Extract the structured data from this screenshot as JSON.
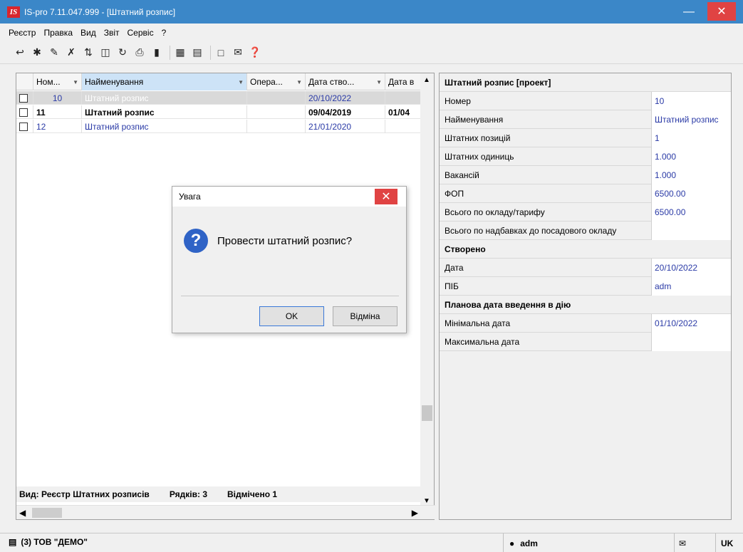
{
  "window": {
    "title": "IS-pro 7.11.047.999 - [Штатний розпис]",
    "logo": "IS"
  },
  "menu": [
    "Реєстр",
    "Правка",
    "Вид",
    "Звіт",
    "Сервіс",
    "?"
  ],
  "grid": {
    "columns": [
      "Ном...",
      "Найменування",
      "Опера...",
      "Дата ство...",
      "Дата в"
    ],
    "rows": [
      {
        "checked": true,
        "num": "10",
        "name": "Штатний розпис",
        "op": "",
        "created": "20/10/2022",
        "date_in": ""
      },
      {
        "checked": false,
        "num": "11",
        "name": "Штатний розпис",
        "op": "",
        "created": "09/04/2019",
        "date_in": "01/04"
      },
      {
        "checked": false,
        "num": "12",
        "name": "Штатний розпис",
        "op": "",
        "created": "21/01/2020",
        "date_in": ""
      }
    ],
    "status": {
      "view": "Вид: Реєстр Штатних розписів",
      "rows": "Рядків: 3",
      "marked": "Відмічено 1"
    }
  },
  "props": {
    "header": "Штатний розпис [проект]",
    "rows": [
      {
        "label": "Номер",
        "value": "10"
      },
      {
        "label": "Найменування",
        "value": "Штатний розпис"
      },
      {
        "label": "Штатних позицій",
        "value": "1"
      },
      {
        "label": "Штатних одиниць",
        "value": "1.000"
      },
      {
        "label": "Вакансій",
        "value": "1.000"
      },
      {
        "label": "ФОП",
        "value": "6500.00"
      },
      {
        "label": "Всього по окладу/тарифу",
        "value": "6500.00"
      },
      {
        "label": "Всього по надбавках до посадового окладу",
        "value": ""
      }
    ],
    "created_header": "Створено",
    "created_rows": [
      {
        "label": "Дата",
        "value": "20/10/2022"
      },
      {
        "label": "ПІБ",
        "value": "adm"
      }
    ],
    "plan_header": "Планова дата введення в дію",
    "plan_rows": [
      {
        "label": "Мінімальна дата",
        "value": "01/10/2022"
      },
      {
        "label": "Максимальна дата",
        "value": ""
      }
    ]
  },
  "dialog": {
    "title": "Увага",
    "message": "Провести штатний розпис?",
    "ok": "OK",
    "cancel": "Відміна"
  },
  "statusbar": {
    "org": "(3) ТОВ \"ДЕМО\"",
    "user": "adm",
    "lang": "UK"
  },
  "colors": {
    "titlebar": "#3b87c8",
    "close": "#e04343",
    "value_text": "#2a3aa6"
  }
}
